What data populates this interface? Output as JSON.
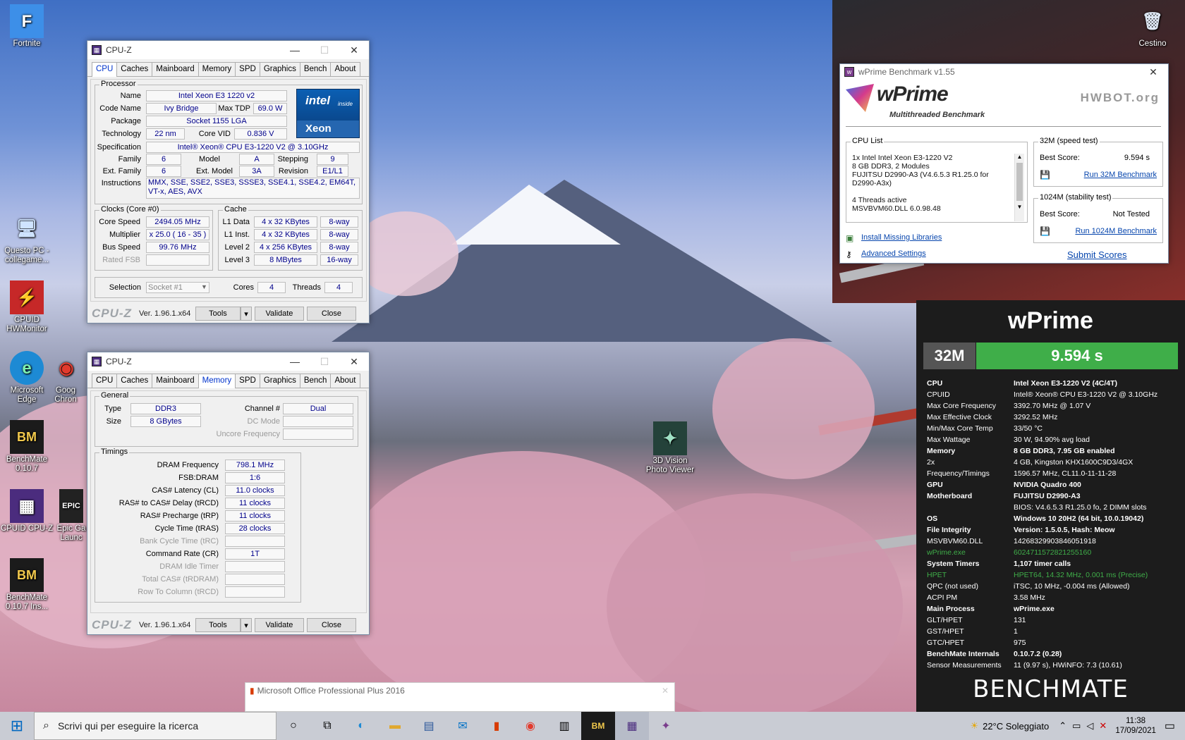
{
  "desktop": {
    "icons": [
      {
        "label": "Fortnite",
        "icon": "fortnite-icon",
        "glyph": "F"
      },
      {
        "label": "Questo PC - collegame...",
        "icon": "computer-icon",
        "glyph": "🖥"
      },
      {
        "label": "CPUID HWMonitor",
        "icon": "hwmonitor-icon",
        "glyph": "⚡"
      },
      {
        "label": "Microsoft Edge",
        "icon": "edge-icon",
        "glyph": "e"
      },
      {
        "label": "Goog Chron",
        "icon": "chrome-icon",
        "glyph": "◉"
      },
      {
        "label": "BenchMate 0.10.7",
        "icon": "benchmate-icon",
        "glyph": "BM"
      },
      {
        "label": "CPUID CPU-Z",
        "icon": "cpuz-icon",
        "glyph": "▦"
      },
      {
        "label": "Epic Ga Launc",
        "icon": "epic-icon",
        "glyph": "EPIC"
      },
      {
        "label": "BenchMate 0.10.7 Ins...",
        "icon": "benchmate-installer-icon",
        "glyph": "BM"
      },
      {
        "label": "Cestino",
        "icon": "recycle-bin-icon",
        "glyph": "🗑"
      },
      {
        "label": "3D Vision Photo Viewer",
        "icon": "photo-viewer-icon",
        "glyph": "✦"
      }
    ]
  },
  "cpuz1": {
    "title": "CPU-Z",
    "tabs": [
      "CPU",
      "Caches",
      "Mainboard",
      "Memory",
      "SPD",
      "Graphics",
      "Bench",
      "About"
    ],
    "active_tab": "CPU",
    "processor_label": "Processor",
    "labels": {
      "name": "Name",
      "code_name": "Code Name",
      "max_tdp": "Max TDP",
      "package": "Package",
      "technology": "Technology",
      "core_vid": "Core VID",
      "specification": "Specification",
      "family": "Family",
      "model": "Model",
      "stepping": "Stepping",
      "ext_family": "Ext. Family",
      "ext_model": "Ext. Model",
      "revision": "Revision",
      "instructions": "Instructions"
    },
    "values": {
      "name": "Intel Xeon E3 1220 v2",
      "code_name": "Ivy Bridge",
      "max_tdp": "69.0 W",
      "package": "Socket 1155 LGA",
      "technology": "22 nm",
      "core_vid": "0.836 V",
      "specification": "Intel® Xeon® CPU E3-1220 V2 @ 3.10GHz",
      "family": "6",
      "model": "A",
      "stepping": "9",
      "ext_family": "6",
      "ext_model": "3A",
      "revision": "E1/L1",
      "instructions": "MMX, SSE, SSE2, SSE3, SSSE3, SSE4.1, SSE4.2, EM64T, VT-x, AES, AVX"
    },
    "badge": {
      "brand": "intel",
      "sub": "inside",
      "product": "Xeon"
    },
    "clocks_label": "Clocks (Core #0)",
    "clocks": [
      {
        "label": "Core Speed",
        "value": "2494.05 MHz"
      },
      {
        "label": "Multiplier",
        "value": "x 25.0 ( 16 - 35 )"
      },
      {
        "label": "Bus Speed",
        "value": "99.76 MHz"
      },
      {
        "label": "Rated FSB",
        "value": ""
      }
    ],
    "cache_label": "Cache",
    "cache": [
      {
        "label": "L1 Data",
        "value": "4 x 32 KBytes",
        "way": "8-way"
      },
      {
        "label": "L1 Inst.",
        "value": "4 x 32 KBytes",
        "way": "8-way"
      },
      {
        "label": "Level 2",
        "value": "4 x 256 KBytes",
        "way": "8-way"
      },
      {
        "label": "Level 3",
        "value": "8 MBytes",
        "way": "16-way"
      }
    ],
    "selection_label": "Selection",
    "selection_value": "Socket #1",
    "cores_label": "Cores",
    "cores": "4",
    "threads_label": "Threads",
    "threads": "4",
    "logo": "CPU-Z",
    "version": "Ver. 1.96.1.x64",
    "tools": "Tools",
    "validate": "Validate",
    "close": "Close"
  },
  "cpuz2": {
    "title": "CPU-Z",
    "tabs": [
      "CPU",
      "Caches",
      "Mainboard",
      "Memory",
      "SPD",
      "Graphics",
      "Bench",
      "About"
    ],
    "active_tab": "Memory",
    "general_label": "General",
    "type_label": "Type",
    "type": "DDR3",
    "size_label": "Size",
    "size": "8 GBytes",
    "channel_label": "Channel #",
    "channel": "Dual",
    "dc_mode_label": "DC Mode",
    "uncore_label": "Uncore Frequency",
    "timings_label": "Timings",
    "timings": [
      {
        "label": "DRAM Frequency",
        "value": "798.1 MHz",
        "enabled": true
      },
      {
        "label": "FSB:DRAM",
        "value": "1:6",
        "enabled": true
      },
      {
        "label": "CAS# Latency (CL)",
        "value": "11.0 clocks",
        "enabled": true
      },
      {
        "label": "RAS# to CAS# Delay (tRCD)",
        "value": "11 clocks",
        "enabled": true
      },
      {
        "label": "RAS# Precharge (tRP)",
        "value": "11 clocks",
        "enabled": true
      },
      {
        "label": "Cycle Time (tRAS)",
        "value": "28 clocks",
        "enabled": true
      },
      {
        "label": "Bank Cycle Time (tRC)",
        "value": "",
        "enabled": false
      },
      {
        "label": "Command Rate (CR)",
        "value": "1T",
        "enabled": true
      },
      {
        "label": "DRAM Idle Timer",
        "value": "",
        "enabled": false
      },
      {
        "label": "Total CAS# (tRDRAM)",
        "value": "",
        "enabled": false
      },
      {
        "label": "Row To Column (tRCD)",
        "value": "",
        "enabled": false
      }
    ],
    "logo": "CPU-Z",
    "version": "Ver. 1.96.1.x64",
    "tools": "Tools",
    "validate": "Validate",
    "close": "Close"
  },
  "wprime": {
    "title": "wPrime Benchmark v1.55",
    "logo": "wPrime",
    "tagline": "Multithreaded Benchmark",
    "hwbot": "HWBOT.org",
    "cpu_list_label": "CPU List",
    "cpu_list": [
      "1x Intel Intel Xeon E3-1220 V2",
      "8 GB DDR3, 2 Modules",
      "FUJITSU D2990-A3 (V4.6.5.3 R1.25.0 for D2990-A3x)",
      "",
      "4 Threads active",
      "MSVBVM60.DLL 6.0.98.48"
    ],
    "install_libs": "Install Missing Libraries",
    "advanced": "Advanced Settings",
    "speed_label": "32M (speed test)",
    "best_score_label": "Best Score:",
    "speed_score": "9.594 s",
    "run_32m": "Run 32M Benchmark",
    "stability_label": "1024M (stability test)",
    "stability_score": "Not Tested",
    "run_1024m": "Run 1024M Benchmark",
    "submit": "Submit Scores"
  },
  "office_notification": "Microsoft Office Professional Plus 2016",
  "benchmate": {
    "title": "wPrime",
    "mode": "32M",
    "score": "9.594 s",
    "accent": "#3fae49",
    "rows": [
      {
        "label": "CPU",
        "value": "Intel Xeon E3-1220 V2 (4C/4T)",
        "bold": true,
        "green": false
      },
      {
        "label": "CPUID",
        "value": "Intel® Xeon® CPU E3-1220 V2 @ 3.10GHz",
        "bold": false,
        "green": false
      },
      {
        "label": "Max Core Frequency",
        "value": "3392.70 MHz @ 1.07 V",
        "bold": false,
        "green": false
      },
      {
        "label": "Max Effective Clock",
        "value": "3292.52 MHz",
        "bold": false,
        "green": false
      },
      {
        "label": "Min/Max Core Temp",
        "value": "33/50 °C",
        "bold": false,
        "green": false
      },
      {
        "label": "Max Wattage",
        "value": "30 W, 94.90% avg load",
        "bold": false,
        "green": false
      },
      {
        "label": "Memory",
        "value": "8 GB DDR3, 7.95 GB enabled",
        "bold": true,
        "green": false
      },
      {
        "label": "2x",
        "value": "4 GB, Kingston KHX1600C9D3/4GX",
        "bold": false,
        "green": false
      },
      {
        "label": "Frequency/Timings",
        "value": "1596.57 MHz, CL11.0-11-11-28",
        "bold": false,
        "green": false
      },
      {
        "label": "GPU",
        "value": "NVIDIA Quadro 400",
        "bold": true,
        "green": false
      },
      {
        "label": "Motherboard",
        "value": "FUJITSU D2990-A3",
        "bold": true,
        "green": false
      },
      {
        "label": "",
        "value": "BIOS: V4.6.5.3 R1.25.0 fo, 2 DIMM slots",
        "bold": false,
        "green": false
      },
      {
        "label": "OS",
        "value": "Windows 10 20H2 (64 bit, 10.0.19042)",
        "bold": true,
        "green": false
      },
      {
        "label": "File Integrity",
        "value": "Version: 1.5.0.5, Hash: Meow",
        "bold": true,
        "green": false
      },
      {
        "label": "MSVBVM60.DLL",
        "value": "14268329903846051918",
        "bold": false,
        "green": false
      },
      {
        "label": "wPrime.exe",
        "value": "6024711572821255160",
        "bold": false,
        "green": true
      },
      {
        "label": "System Timers",
        "value": "1,107 timer calls",
        "bold": true,
        "green": false
      },
      {
        "label": "HPET",
        "value": "HPET64, 14.32 MHz, 0.001 ms (Precise)",
        "bold": false,
        "green": true
      },
      {
        "label": "QPC (not used)",
        "value": "iTSC, 10 MHz, -0.004 ms (Allowed)",
        "bold": false,
        "green": false
      },
      {
        "label": "ACPI PM",
        "value": "3.58 MHz",
        "bold": false,
        "green": false
      },
      {
        "label": "Main Process",
        "value": "wPrime.exe",
        "bold": true,
        "green": false
      },
      {
        "label": "GLT/HPET",
        "value": "131",
        "bold": false,
        "green": false
      },
      {
        "label": "GST/HPET",
        "value": "1",
        "bold": false,
        "green": false
      },
      {
        "label": "GTC/HPET",
        "value": "975",
        "bold": false,
        "green": false
      },
      {
        "label": "BenchMate Internals",
        "value": "0.10.7.2 (0.28)",
        "bold": true,
        "green": false
      },
      {
        "label": "Sensor Measurements",
        "value": "11 (9.97 s), HWiNFO: 7.3 (10.61)",
        "bold": false,
        "green": false
      }
    ],
    "footer": "BENCHMATE"
  },
  "taskbar": {
    "search_placeholder": "Scrivi qui per eseguire la ricerca",
    "weather": "22°C  Soleggiato",
    "time": "11:38",
    "date": "17/09/2021"
  }
}
